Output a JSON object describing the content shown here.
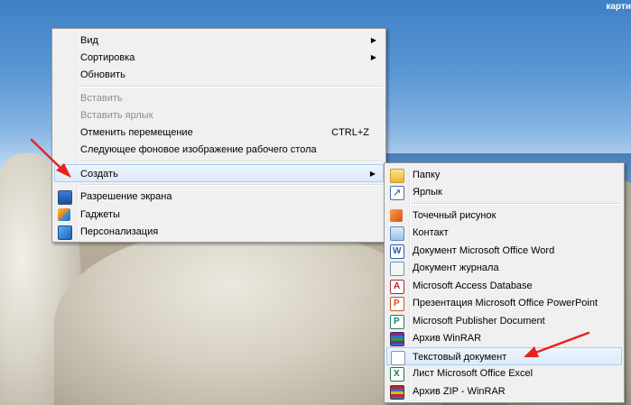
{
  "desktop": {
    "corner_text": "карти"
  },
  "context_menu": {
    "view": "Вид",
    "sort": "Сортировка",
    "refresh": "Обновить",
    "paste": "Вставить",
    "paste_shortcut": "Вставить ярлык",
    "undo_move": "Отменить перемещение",
    "undo_shortcut_key": "CTRL+Z",
    "next_background": "Следующее фоновое изображение рабочего стола",
    "create": "Создать",
    "screen_resolution": "Разрешение экрана",
    "gadgets": "Гаджеты",
    "personalize": "Персонализация",
    "submenu_arrow": "▶"
  },
  "create_submenu": {
    "folder": "Папку",
    "shortcut": "Ярлык",
    "bitmap": "Точечный рисунок",
    "contact": "Контакт",
    "word": "Документ Microsoft Office Word",
    "journal": "Документ журнала",
    "access": "Microsoft Access Database",
    "powerpoint": "Презентация Microsoft Office PowerPoint",
    "publisher": "Microsoft Publisher Document",
    "winrar": "Архив WinRAR",
    "text_document": "Текстовый документ",
    "excel": "Лист Microsoft Office Excel",
    "zip": "Архив ZIP - WinRAR"
  },
  "colors": {
    "annotation_arrow": "#e8231f",
    "highlight": "#dcebfb",
    "menu_bg": "#f0f0f0"
  }
}
